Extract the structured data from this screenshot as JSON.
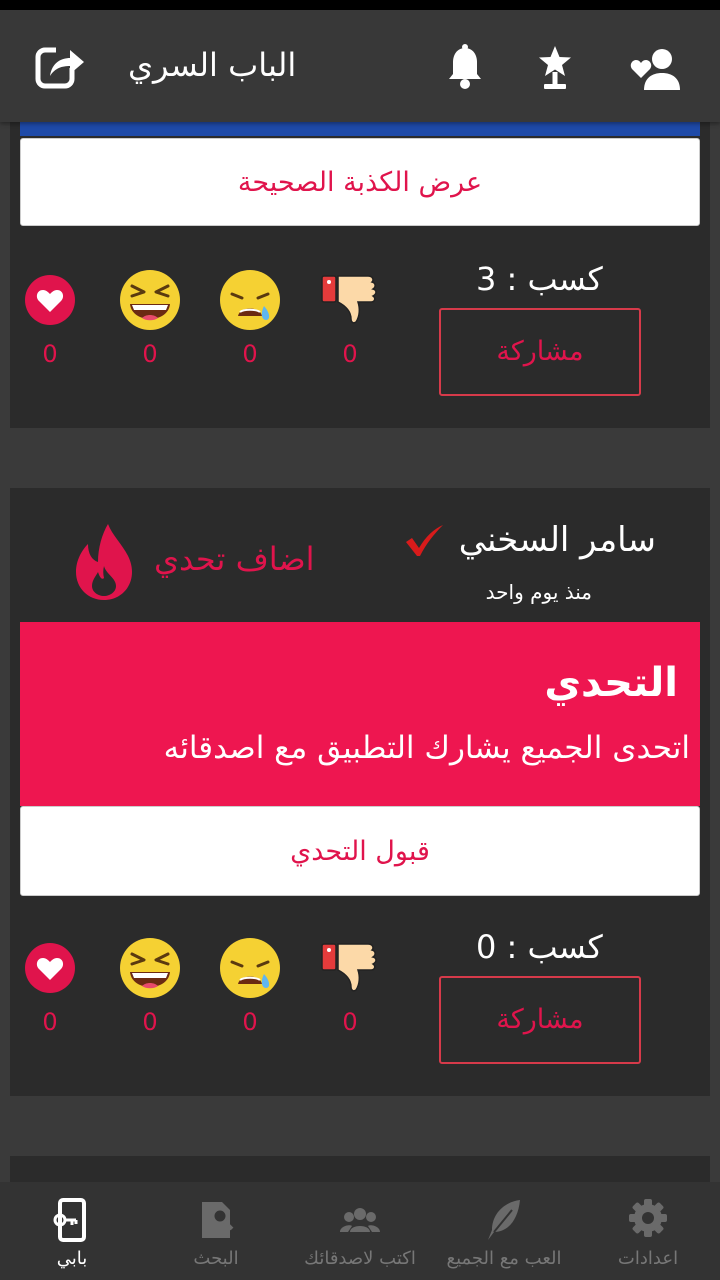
{
  "app": {
    "title": "الباب السري"
  },
  "post1": {
    "reveal_button": "عرض الكذبة الصحيحة",
    "earn_text": "كسب : 3",
    "share_label": "مشاركة",
    "counts": [
      "0",
      "0",
      "0",
      "0"
    ]
  },
  "post2": {
    "author_name": "سامر السخني",
    "time": "منذ يوم واحد",
    "added_label": "اضاف تحدي",
    "banner_title": "التحدي",
    "banner_text": "اتحدى الجميع يشارك التطبيق مع اصدقائه",
    "accept_button": "قبول التحدي",
    "earn_text": "كسب : 0",
    "share_label": "مشاركة",
    "counts": [
      "0",
      "0",
      "0",
      "0"
    ]
  },
  "nav": {
    "items": [
      "بابي",
      "البحث",
      "اكتب لاصدقائك",
      "العب مع الجميع",
      "اعدادات"
    ]
  },
  "colors": {
    "accent": "#e0144c",
    "card": "#2b2b2b",
    "background": "#3a3a3a",
    "heart": "#e0144c",
    "emoji": "#f5d133"
  }
}
